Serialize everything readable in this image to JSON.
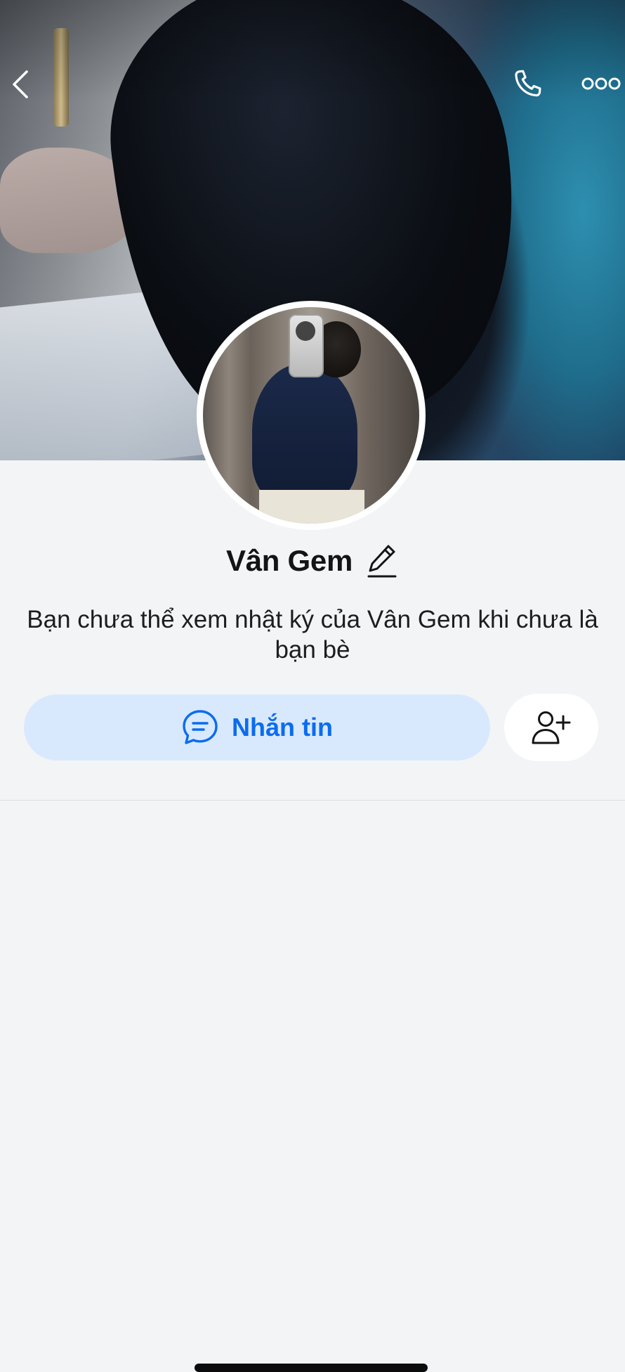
{
  "profile": {
    "name": "Vân Gem",
    "info_text": "Bạn chưa thể xem nhật ký của Vân Gem khi chưa là bạn bè"
  },
  "topbar": {
    "back_icon": "chevron-left-icon",
    "call_icon": "phone-icon",
    "more_icon": "more-dots-icon"
  },
  "actions": {
    "message_label": "Nhắn tin",
    "message_icon": "chat-bubble-icon",
    "add_friend_icon": "add-user-icon",
    "edit_icon": "pencil-icon"
  },
  "colors": {
    "accent": "#0b6cf0",
    "message_button_bg": "#d9e9fd",
    "page_bg": "#f3f4f6"
  }
}
